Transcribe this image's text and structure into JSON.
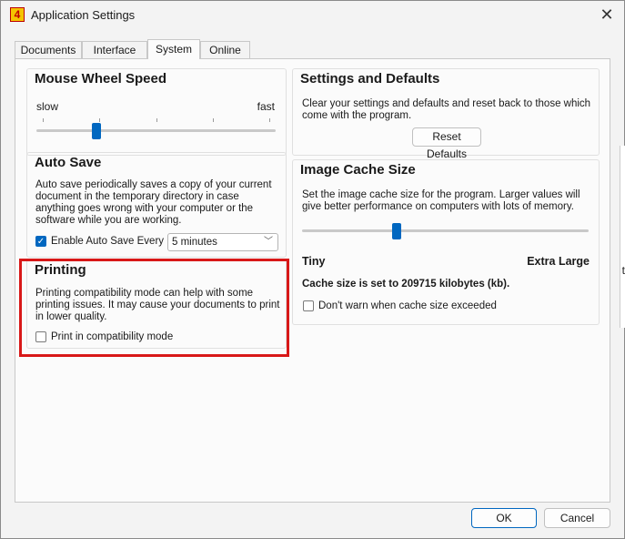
{
  "window": {
    "title": "Application Settings",
    "icon_label": "4"
  },
  "tabs": [
    {
      "label": "Documents"
    },
    {
      "label": "Interface"
    },
    {
      "label": "System",
      "active": true
    },
    {
      "label": "Online"
    }
  ],
  "mouse_wheel": {
    "title": "Mouse Wheel Speed",
    "min_label": "slow",
    "max_label": "fast",
    "level": 0.25
  },
  "auto_save": {
    "title": "Auto Save",
    "description": "Auto save periodically saves a copy of your current document in the temporary directory in case anything goes wrong with your computer or the software while you are working.",
    "checkbox_label": "Enable Auto Save Every",
    "checked": true,
    "interval_value": "5 minutes"
  },
  "printing": {
    "title": "Printing",
    "description": "Printing compatibility mode can help with some printing issues. It may cause your documents to print in lower quality.",
    "checkbox_label": "Print in compatibility mode",
    "checked": false
  },
  "settings_defaults": {
    "title": "Settings and Defaults",
    "description": "Clear your settings and defaults and reset back to those which come with the program.",
    "reset_label": "Reset Defaults"
  },
  "image_cache": {
    "title": "Image Cache Size",
    "description": "Set the image cache size for the program. Larger values will give better performance on computers with lots of memory.",
    "min_label": "Tiny",
    "max_label": "Extra Large",
    "level": 0.33,
    "status": "Cache size is set to 209715 kilobytes (kb).",
    "checkbox_label": "Don't warn when cache size exceeded",
    "checked": false
  },
  "footer": {
    "ok_label": "OK",
    "cancel_label": "Cancel"
  },
  "colors": {
    "accent": "#0067c0",
    "highlight": "#d81818"
  },
  "background": {
    "right_text": "t"
  }
}
